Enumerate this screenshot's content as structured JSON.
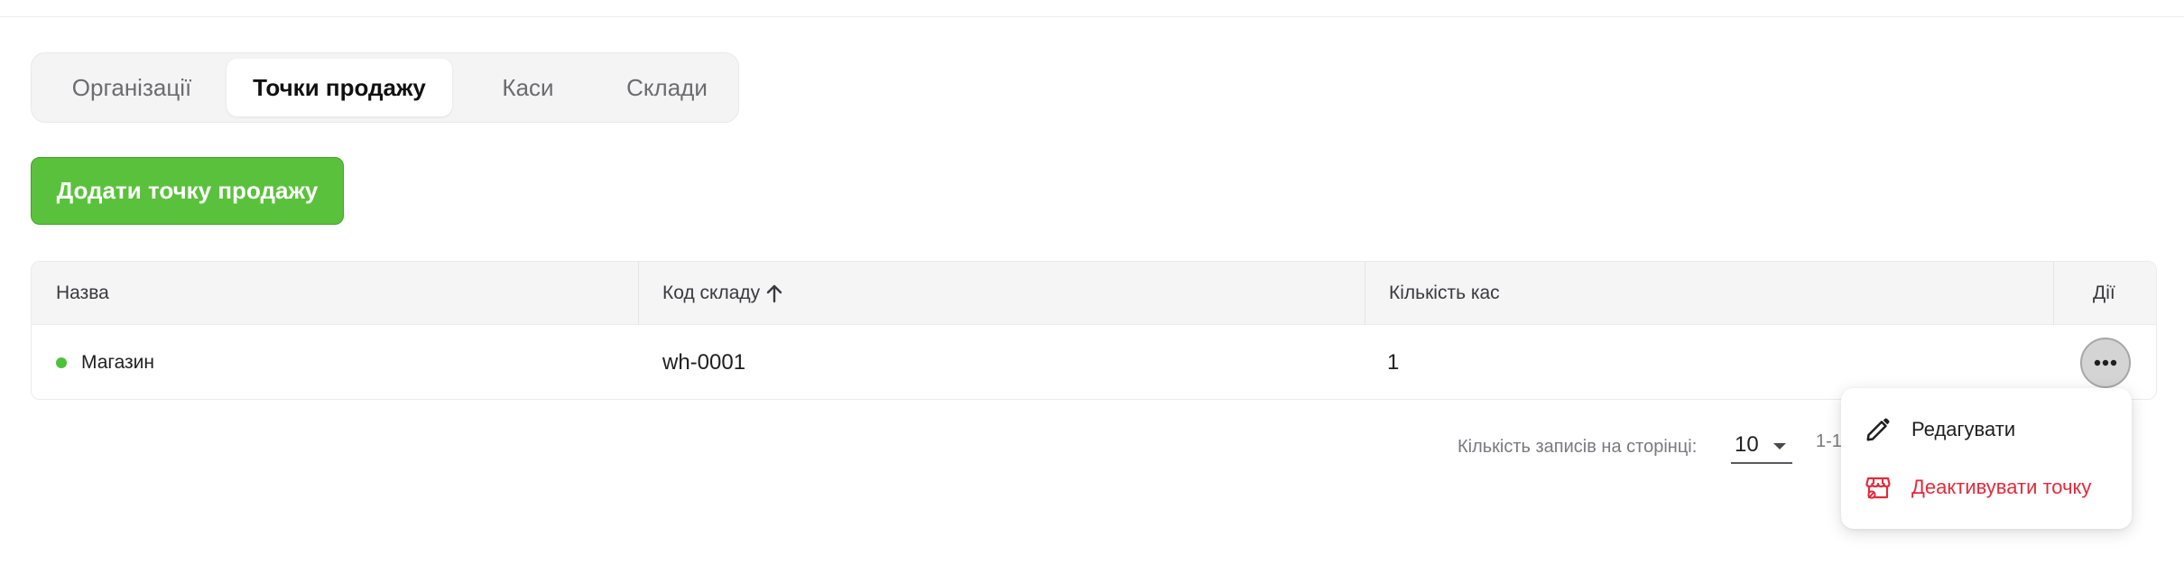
{
  "tabs": [
    {
      "label": "Організації",
      "active": false
    },
    {
      "label": "Точки продажу",
      "active": true
    },
    {
      "label": "Каси",
      "active": false
    },
    {
      "label": "Склади",
      "active": false
    }
  ],
  "add_button": {
    "label": "Додати точку продажу"
  },
  "table": {
    "headers": {
      "name": "Назва",
      "warehouse_code": "Код складу",
      "cash_count": "Кількість кас",
      "actions": "Дії"
    },
    "sort_icon": "arrow-up-icon",
    "rows": [
      {
        "name": "Магазин",
        "warehouse_code": "wh-0001",
        "cash_count": "1",
        "status_color": "#4cc23a"
      }
    ]
  },
  "pagination": {
    "rows_per_page_label": "Кількість записів на сторінці:",
    "rows_per_page_value": "10",
    "range": "1-1"
  },
  "menu": {
    "items": [
      {
        "label": "Редагувати",
        "icon": "pencil-icon",
        "color": "#1f1f1f"
      },
      {
        "label": "Деактивувати точку",
        "icon": "store-off-icon",
        "color": "#e02b3c"
      }
    ]
  },
  "colors": {
    "accent_green": "#5ac13c",
    "danger_red": "#e02b3c"
  }
}
